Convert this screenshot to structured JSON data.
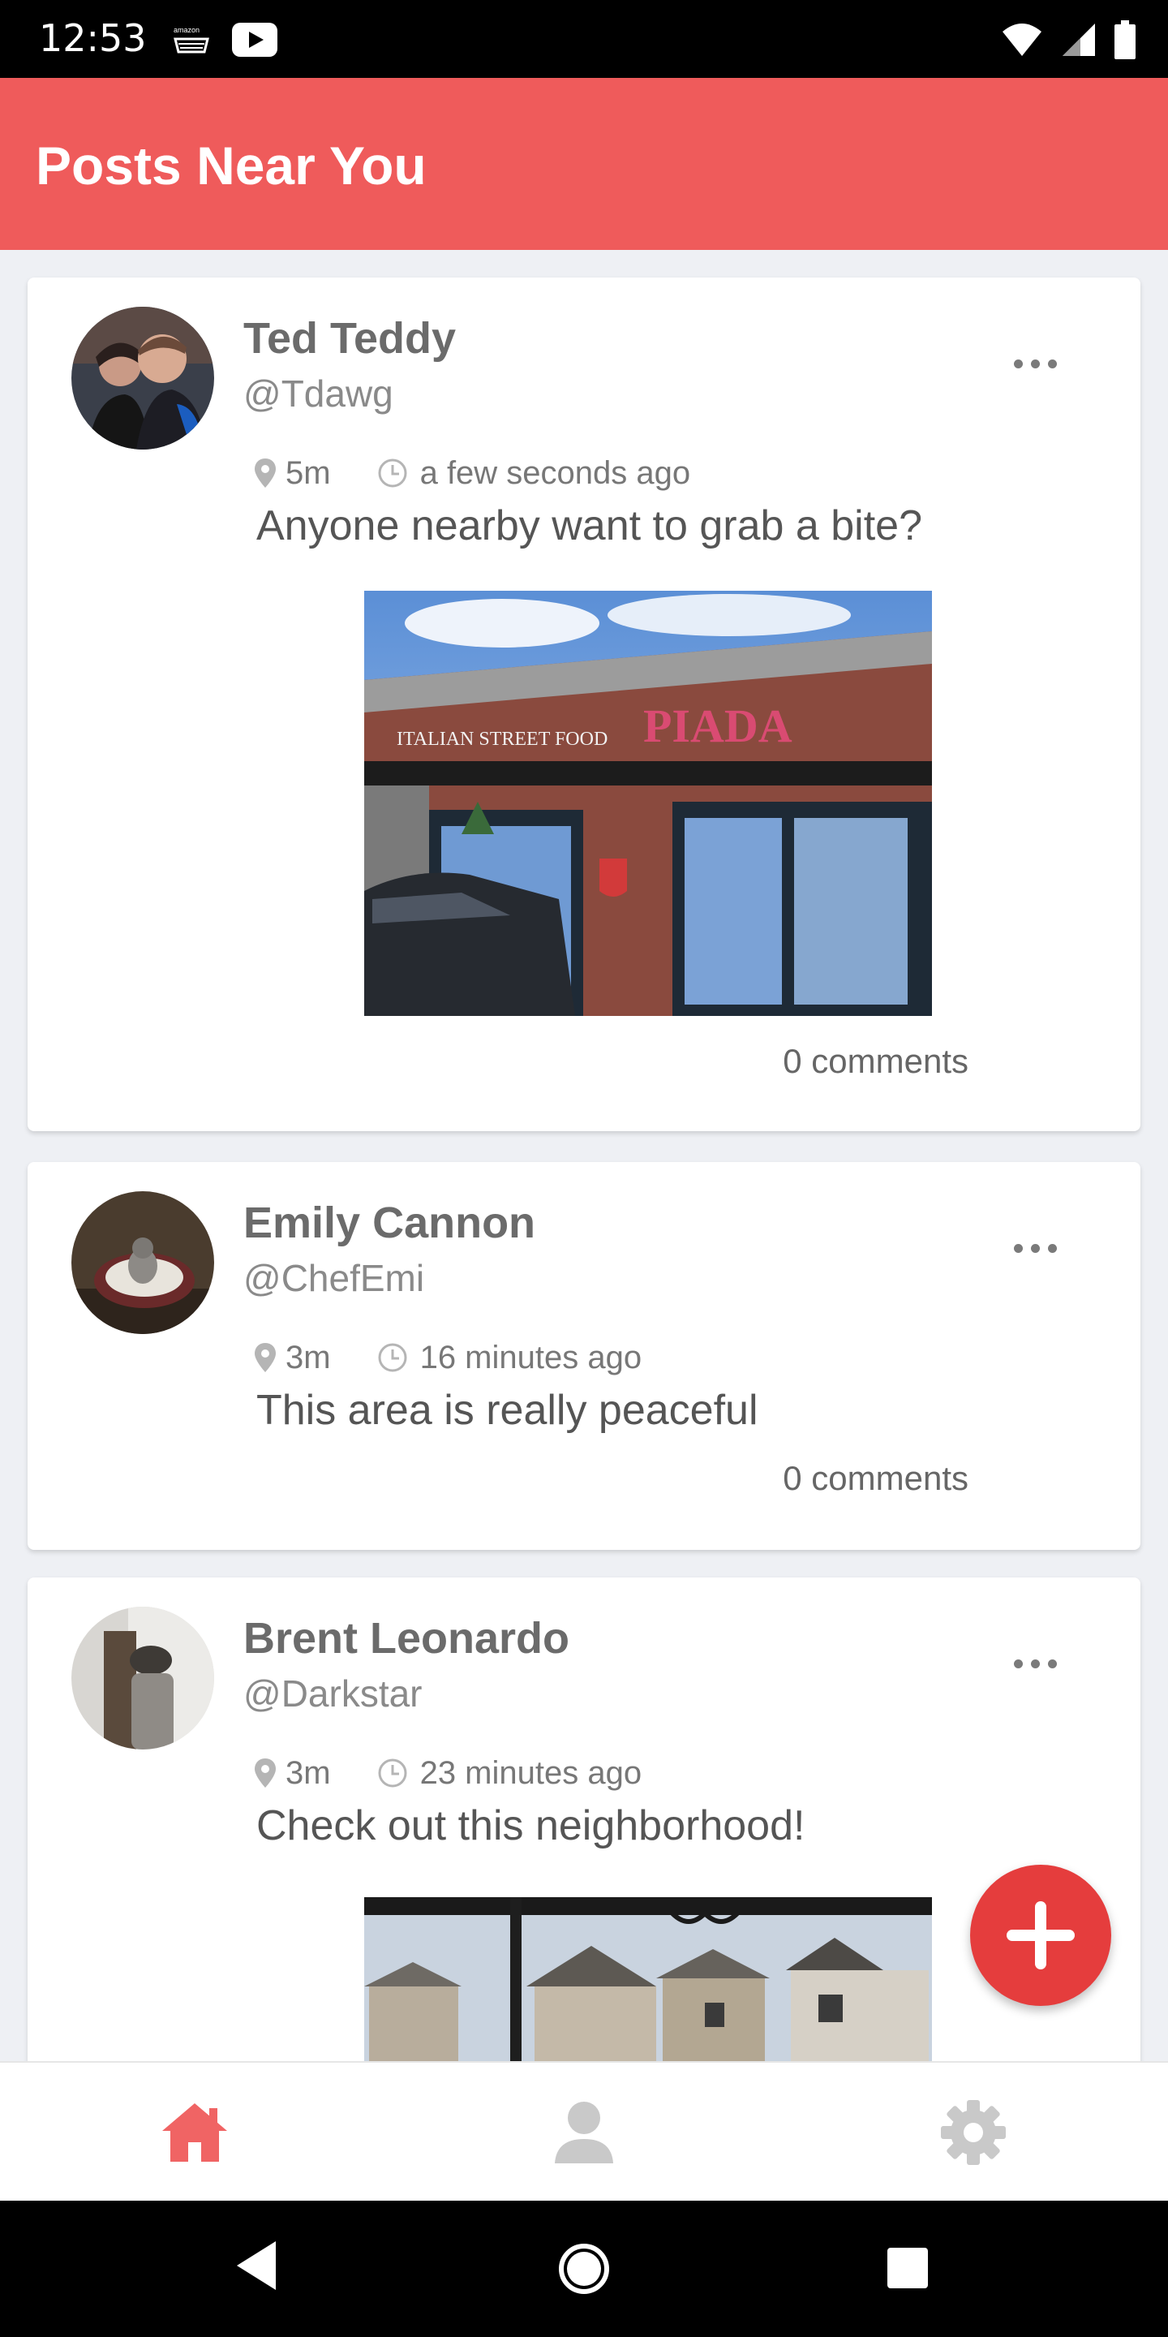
{
  "status_bar": {
    "time": "12:53",
    "icons": [
      "amazon-icon",
      "youtube-icon",
      "wifi-icon",
      "signal-icon",
      "battery-icon"
    ]
  },
  "header": {
    "title": "Posts Near You"
  },
  "colors": {
    "accent": "#ef5b5b",
    "fab": "#e53d3d",
    "nav_active": "#f06464",
    "nav_inactive": "#c9c9c9"
  },
  "posts": [
    {
      "name": "Ted Teddy",
      "handle": "@Tdawg",
      "distance": "5m",
      "time": "a few seconds ago",
      "text": "Anyone nearby want to grab a bite?",
      "comments": "0 comments",
      "image_text": {
        "line1": "ITALIAN STREET FOOD",
        "line2": "PIADA"
      }
    },
    {
      "name": "Emily Cannon",
      "handle": "@ChefEmi",
      "distance": "3m",
      "time": "16 minutes ago",
      "text": "This area is really peaceful",
      "comments": "0 comments"
    },
    {
      "name": "Brent Leonardo",
      "handle": "@Darkstar",
      "distance": "3m",
      "time": "23 minutes ago",
      "text": "Check out this neighborhood!"
    }
  ],
  "bottom_nav": {
    "items": [
      "home-icon",
      "profile-icon",
      "settings-icon"
    ],
    "active": "home-icon"
  },
  "system_nav": [
    "back-button",
    "home-button",
    "recents-button"
  ]
}
